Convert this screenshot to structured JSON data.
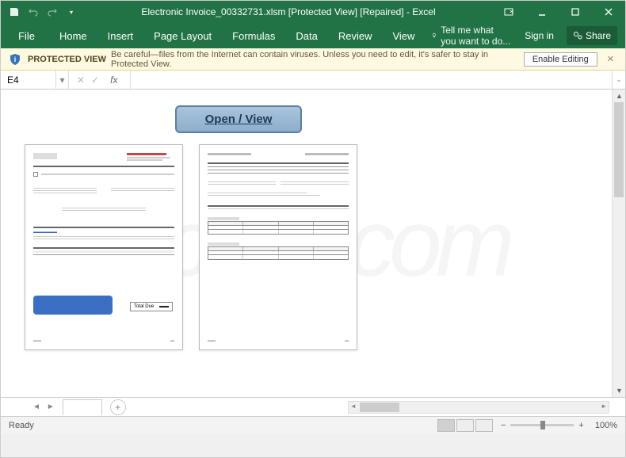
{
  "titlebar": {
    "title": "Electronic Invoice_00332731.xlsm  [Protected View] [Repaired] - Excel"
  },
  "ribbon": {
    "tabs": [
      "File",
      "Home",
      "Insert",
      "Page Layout",
      "Formulas",
      "Data",
      "Review",
      "View"
    ],
    "tellme": "Tell me what you want to do...",
    "signin": "Sign in",
    "share": "Share"
  },
  "protected": {
    "title": "PROTECTED VIEW",
    "message": "Be careful—files from the Internet can contain viruses. Unless you need to edit, it's safer to stay in Protected View.",
    "enable": "Enable Editing"
  },
  "formula": {
    "cellref": "E4",
    "fx": "fx"
  },
  "content": {
    "open_button": "Open / View",
    "total_label": "Total Due"
  },
  "statusbar": {
    "ready": "Ready",
    "zoom": "100%"
  }
}
